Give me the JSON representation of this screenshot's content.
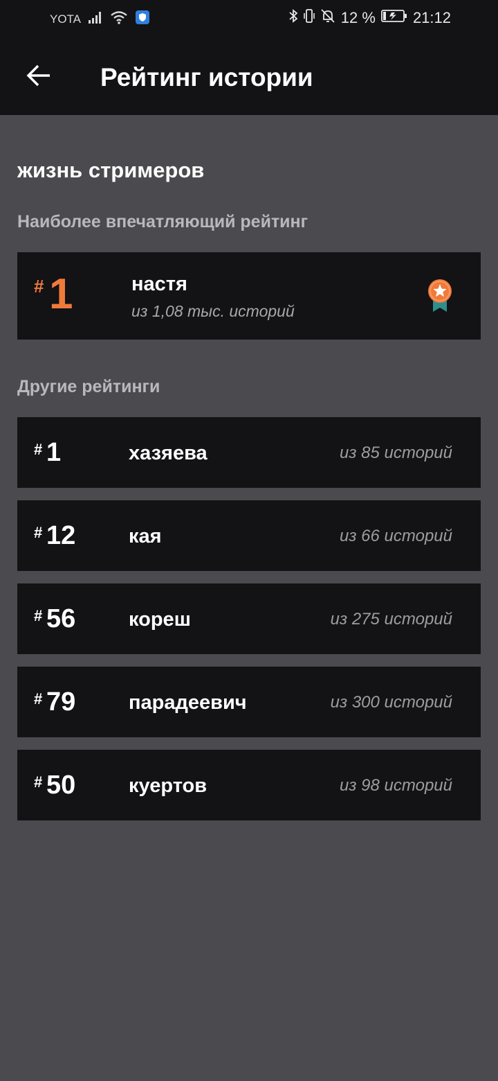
{
  "status_bar": {
    "carrier": "YOTA",
    "battery_percent": "12 %",
    "time": "21:12",
    "icons": [
      "signal-icon",
      "wifi-icon",
      "shield-icon",
      "bluetooth-icon",
      "vibrate-icon",
      "mute-bell-icon",
      "battery-icon"
    ]
  },
  "header": {
    "title": "Рейтинг истории",
    "back_icon": "arrow-left-icon"
  },
  "story": {
    "name": "жизнь стримеров"
  },
  "featured_section": {
    "title": "Наиболее впечатляющий рейтинг",
    "item": {
      "hash": "#",
      "rank": "1",
      "name": "настя",
      "subtitle": "из 1,08 тыс. историй",
      "icon": "medal-icon"
    }
  },
  "other_section": {
    "title": "Другие рейтинги",
    "items": [
      {
        "hash": "#",
        "rank": "1",
        "name": "хазяева",
        "subtitle": "из 85 историй"
      },
      {
        "hash": "#",
        "rank": "12",
        "name": "кая",
        "subtitle": "из 66 историй"
      },
      {
        "hash": "#",
        "rank": "56",
        "name": "кореш",
        "subtitle": "из 275 историй"
      },
      {
        "hash": "#",
        "rank": "79",
        "name": "парадеевич",
        "subtitle": "из 300 историй"
      },
      {
        "hash": "#",
        "rank": "50",
        "name": "куертов",
        "subtitle": "из 98 историй"
      }
    ]
  },
  "colors": {
    "accent": "#f07a3a",
    "background": "#4b4a4e",
    "card": "#131215",
    "medal_ribbon": "#2e8f8c"
  }
}
